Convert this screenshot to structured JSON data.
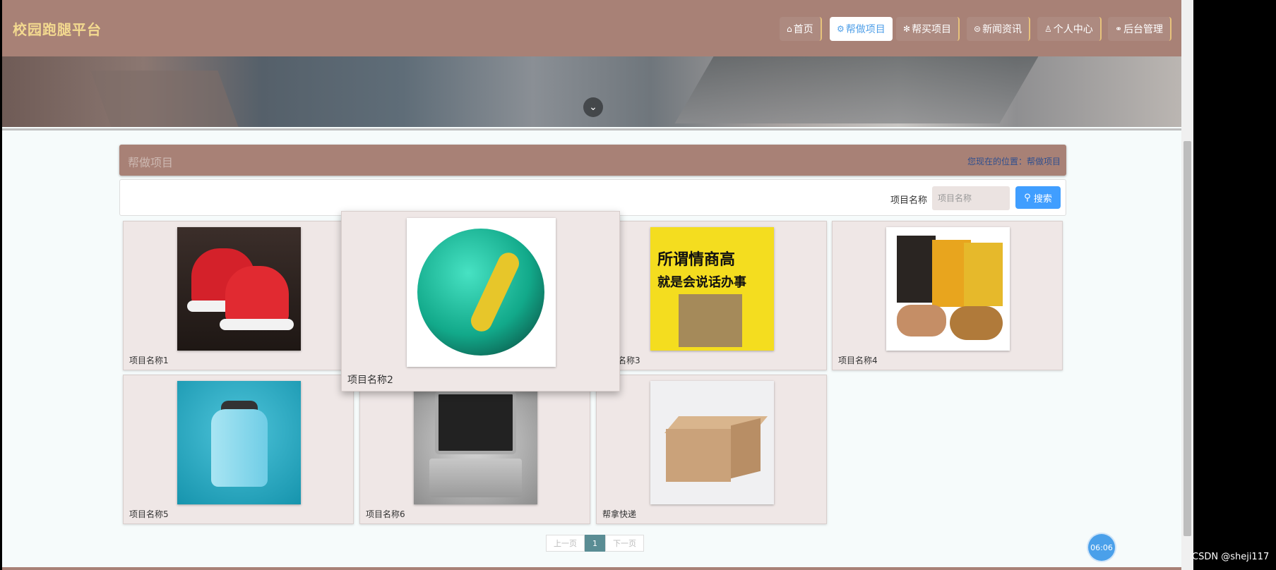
{
  "brand": "校园跑腿平台",
  "nav": [
    {
      "icon": "⌂",
      "label": "首页"
    },
    {
      "icon": "⚙",
      "label": "帮做项目"
    },
    {
      "icon": "✻",
      "label": "帮买项目"
    },
    {
      "icon": "⊜",
      "label": "新闻资讯"
    },
    {
      "icon": "♙",
      "label": "个人中心"
    },
    {
      "icon": "⚭",
      "label": "后台管理"
    }
  ],
  "section": {
    "title": "帮做项目",
    "crumb": "您现在的位置：帮做项目"
  },
  "search": {
    "label": "项目名称",
    "placeholder": "项目名称",
    "button": "搜索"
  },
  "items": [
    {
      "name": "项目名称1"
    },
    {
      "name": "项目名称2"
    },
    {
      "name": "名称3"
    },
    {
      "name": "项目名称4"
    },
    {
      "name": "项目名称5"
    },
    {
      "name": "项目名称6"
    },
    {
      "name": "帮拿快递"
    }
  ],
  "book_cover": {
    "line1": "所谓情商高",
    "line2": "就是会说话办事"
  },
  "pager": {
    "prev": "上一页",
    "current": "1",
    "next": "下一页"
  },
  "timer": "06:06",
  "watermark": "CSDN @sheji117"
}
